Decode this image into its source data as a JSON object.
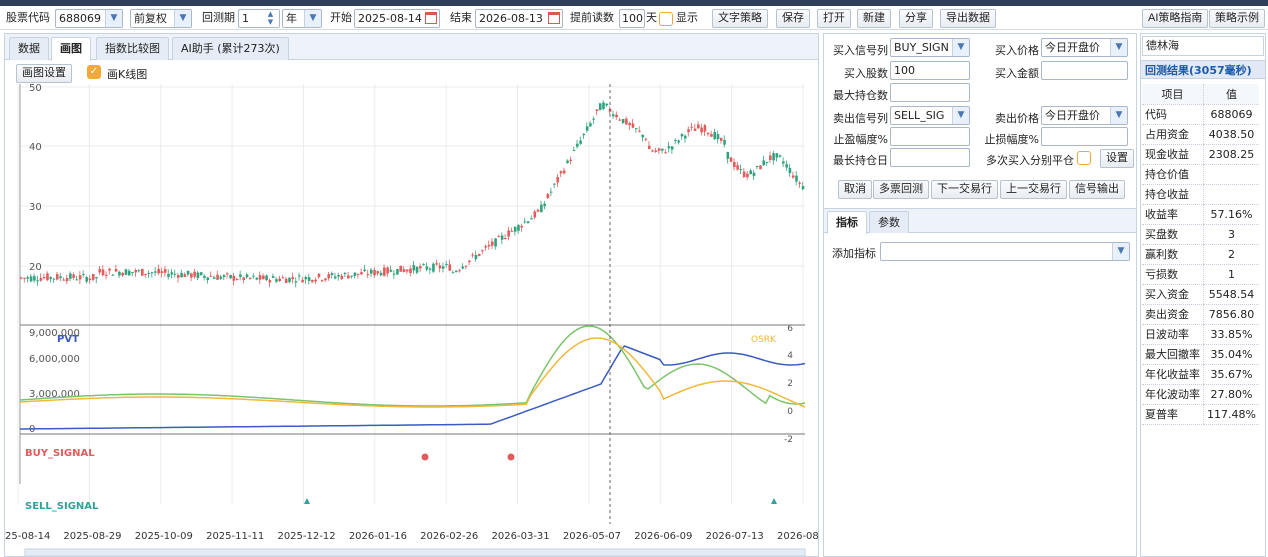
{
  "toolbar": {
    "stock_code_label": "股票代码",
    "stock_code": "688069",
    "adjust": "前复权",
    "period_label": "回测期",
    "period_value": "1",
    "period_unit": "年",
    "start_label": "开始",
    "start_date": "2025-08-14",
    "end_label": "结束",
    "end_date": "2026-08-13",
    "preload_label": "提前读数",
    "preload_value": "100",
    "preload_unit": "天",
    "show_label": "显示",
    "buttons": [
      "文字策略",
      "保存",
      "打开",
      "新建",
      "分享",
      "导出数据"
    ],
    "right_buttons": [
      "AI策略指南",
      "策略示例"
    ]
  },
  "left": {
    "tabs": [
      "数据",
      "画图",
      "指数比较图",
      "AI助手 (累计273次)"
    ],
    "chart_settings": "画图设置",
    "kline_label": "画K线图"
  },
  "chart_data": {
    "type": "line",
    "price_axis": {
      "ticks": [
        "50",
        "40",
        "30",
        "20"
      ]
    },
    "pvt_axis": {
      "ticks": [
        "9,000,000",
        "6,000,000",
        "3,000,000",
        "0"
      ]
    },
    "osc_axis": {
      "ticks": [
        "6",
        "4",
        "2",
        "0",
        "-2"
      ]
    },
    "x_ticks": [
      "25-08-14",
      "2025-08-29",
      "2025-10-09",
      "2025-11-11",
      "2025-12-12",
      "2026-01-16",
      "2026-02-26",
      "2026-03-31",
      "2026-05-07",
      "2026-06-09",
      "2026-07-13",
      "2026-08-"
    ],
    "series_labels": {
      "pvt": "PVT",
      "osc": "OSRK",
      "buy": "BUY_SIGNAL",
      "sell": "SELL_SIGNAL"
    },
    "colors": {
      "up": "#e35b5b",
      "down": "#2fa37f",
      "pvt": "#3a5bbf",
      "osc1": "#7cc46a",
      "osc2": "#f0b93b",
      "buy": "#e35b5b",
      "sell": "#2fa39a"
    }
  },
  "mid": {
    "buy_signal_label": "买入信号列",
    "buy_signal": "BUY_SIGN",
    "buy_price_label": "买入价格",
    "buy_price": "今日开盘价",
    "buy_shares_label": "买入股数",
    "buy_shares": "100",
    "buy_amount_label": "买入金额",
    "max_hold_label": "最大持仓数",
    "sell_signal_label": "卖出信号列",
    "sell_signal": "SELL_SIG",
    "sell_price_label": "卖出价格",
    "sell_price": "今日开盘价",
    "take_profit_label": "止盈幅度%",
    "stop_loss_label": "止损幅度%",
    "max_days_label": "最长持仓日",
    "multi_buy_label": "多次买入分别平仓",
    "set_label": "设置",
    "action_buttons": [
      "取消",
      "多票回测",
      "下一交易行",
      "上一交易行",
      "信号输出"
    ],
    "sub_tabs": [
      "指标",
      "参数"
    ],
    "add_indicator_label": "添加指标"
  },
  "right": {
    "name": "德林海",
    "result_title": "回测结果(3057毫秒)",
    "header": [
      "项目",
      "值"
    ],
    "rows": [
      [
        "代码",
        "688069"
      ],
      [
        "占用资金",
        "4038.50"
      ],
      [
        "现金收益",
        "2308.25"
      ],
      [
        "持仓价值",
        ""
      ],
      [
        "持仓收益",
        ""
      ],
      [
        "收益率",
        "57.16%"
      ],
      [
        "买盘数",
        "3"
      ],
      [
        "赢利数",
        "2"
      ],
      [
        "亏损数",
        "1"
      ],
      [
        "买入资金",
        "5548.54"
      ],
      [
        "卖出资金",
        "7856.80"
      ],
      [
        "日波动率",
        "33.85%"
      ],
      [
        "最大回撤率",
        "35.04%"
      ],
      [
        "年化收益率",
        "35.67%"
      ],
      [
        "年化波动率",
        "27.80%"
      ],
      [
        "夏普率",
        "117.48%"
      ]
    ]
  }
}
